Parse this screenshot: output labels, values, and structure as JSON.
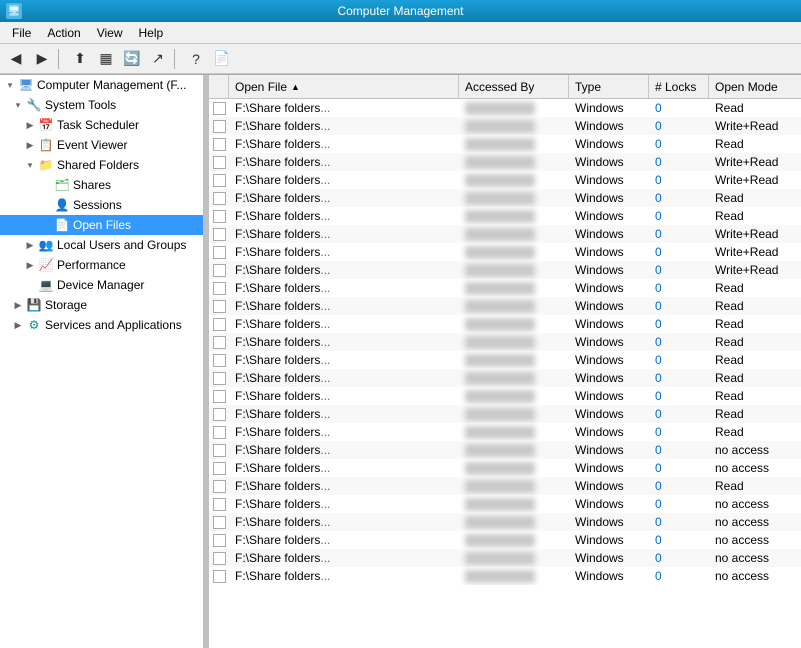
{
  "titleBar": {
    "title": "Computer Management",
    "icon": "🖥"
  },
  "menuBar": {
    "items": [
      "File",
      "Action",
      "View",
      "Help"
    ]
  },
  "toolbar": {
    "buttons": [
      "◀",
      "▶",
      "⬆",
      "📋",
      "🔄",
      "🔍",
      "✔",
      "📄"
    ]
  },
  "tree": {
    "items": [
      {
        "id": "root",
        "label": "Computer Management (F...",
        "icon": "🖥",
        "indent": 0,
        "expanded": true,
        "hasChildren": true
      },
      {
        "id": "system-tools",
        "label": "System Tools",
        "icon": "🔧",
        "indent": 1,
        "expanded": true,
        "hasChildren": true
      },
      {
        "id": "task-scheduler",
        "label": "Task Scheduler",
        "icon": "📅",
        "indent": 2,
        "expanded": false,
        "hasChildren": true
      },
      {
        "id": "event-viewer",
        "label": "Event Viewer",
        "icon": "📋",
        "indent": 2,
        "expanded": false,
        "hasChildren": true
      },
      {
        "id": "shared-folders",
        "label": "Shared Folders",
        "icon": "📁",
        "indent": 2,
        "expanded": true,
        "hasChildren": true
      },
      {
        "id": "shares",
        "label": "Shares",
        "icon": "🗂",
        "indent": 3,
        "expanded": false,
        "hasChildren": false
      },
      {
        "id": "sessions",
        "label": "Sessions",
        "icon": "👤",
        "indent": 3,
        "expanded": false,
        "hasChildren": false
      },
      {
        "id": "open-files",
        "label": "Open Files",
        "icon": "📄",
        "indent": 3,
        "expanded": false,
        "hasChildren": false,
        "selected": true
      },
      {
        "id": "local-users",
        "label": "Local Users and Groups",
        "icon": "👥",
        "indent": 2,
        "expanded": false,
        "hasChildren": true
      },
      {
        "id": "performance",
        "label": "Performance",
        "icon": "📈",
        "indent": 2,
        "expanded": false,
        "hasChildren": true
      },
      {
        "id": "device-manager",
        "label": "Device Manager",
        "icon": "💻",
        "indent": 2,
        "expanded": false,
        "hasChildren": false
      },
      {
        "id": "storage",
        "label": "Storage",
        "icon": "💾",
        "indent": 1,
        "expanded": false,
        "hasChildren": true
      },
      {
        "id": "services",
        "label": "Services and Applications",
        "icon": "⚙",
        "indent": 1,
        "expanded": false,
        "hasChildren": true
      }
    ]
  },
  "table": {
    "columns": [
      {
        "id": "open-file",
        "label": "Open File",
        "sortable": true,
        "sorted": true,
        "sortDir": "asc"
      },
      {
        "id": "accessed-by",
        "label": "Accessed By",
        "sortable": true
      },
      {
        "id": "type",
        "label": "Type",
        "sortable": true
      },
      {
        "id": "locks",
        "label": "# Locks",
        "sortable": true
      },
      {
        "id": "open-mode",
        "label": "Open Mode",
        "sortable": true
      }
    ],
    "rows": [
      {
        "file": "F:\\Share folders",
        "accessedBy": "blurred1",
        "type": "Windows",
        "locks": "0",
        "mode": "Read"
      },
      {
        "file": "F:\\Share folders",
        "accessedBy": "blurred2",
        "type": "Windows",
        "locks": "0",
        "mode": "Write+Read"
      },
      {
        "file": "F:\\Share folders",
        "accessedBy": "blurred3",
        "type": "Windows",
        "locks": "0",
        "mode": "Read"
      },
      {
        "file": "F:\\Share folders",
        "accessedBy": "blurred4",
        "type": "Windows",
        "locks": "0",
        "mode": "Write+Read"
      },
      {
        "file": "F:\\Share folders",
        "accessedBy": "blurred5",
        "type": "Windows",
        "locks": "0",
        "mode": "Write+Read"
      },
      {
        "file": "F:\\Share folders",
        "accessedBy": "blurred6",
        "type": "Windows",
        "locks": "0",
        "mode": "Read"
      },
      {
        "file": "F:\\Share folders",
        "accessedBy": "blurred7",
        "type": "Windows",
        "locks": "0",
        "mode": "Read"
      },
      {
        "file": "F:\\Share folders",
        "accessedBy": "blurred8",
        "type": "Windows",
        "locks": "0",
        "mode": "Write+Read"
      },
      {
        "file": "F:\\Share folders",
        "accessedBy": "blurred9",
        "type": "Windows",
        "locks": "0",
        "mode": "Write+Read"
      },
      {
        "file": "F:\\Share folders",
        "accessedBy": "blurred10",
        "type": "Windows",
        "locks": "0",
        "mode": "Write+Read"
      },
      {
        "file": "F:\\Share folders",
        "accessedBy": "blurred11",
        "type": "Windows",
        "locks": "0",
        "mode": "Read"
      },
      {
        "file": "F:\\Share folders",
        "accessedBy": "blurred12",
        "type": "Windows",
        "locks": "0",
        "mode": "Read"
      },
      {
        "file": "F:\\Share folders",
        "accessedBy": "blurred13",
        "type": "Windows",
        "locks": "0",
        "mode": "Read"
      },
      {
        "file": "F:\\Share folders",
        "accessedBy": "blurred14",
        "type": "Windows",
        "locks": "0",
        "mode": "Read"
      },
      {
        "file": "F:\\Share folders",
        "accessedBy": "blurred15",
        "type": "Windows",
        "locks": "0",
        "mode": "Read"
      },
      {
        "file": "F:\\Share folders",
        "accessedBy": "blurred16",
        "type": "Windows",
        "locks": "0",
        "mode": "Read"
      },
      {
        "file": "F:\\Share folders",
        "accessedBy": "blurred17",
        "type": "Windows",
        "locks": "0",
        "mode": "Read"
      },
      {
        "file": "F:\\Share folders",
        "accessedBy": "blurred18",
        "type": "Windows",
        "locks": "0",
        "mode": "Read"
      },
      {
        "file": "F:\\Share folders",
        "accessedBy": "blurred19",
        "type": "Windows",
        "locks": "0",
        "mode": "Read"
      },
      {
        "file": "F:\\Share folders",
        "accessedBy": "blurred20",
        "type": "Windows",
        "locks": "0",
        "mode": "no access"
      },
      {
        "file": "F:\\Share folders",
        "accessedBy": "blurred21",
        "type": "Windows",
        "locks": "0",
        "mode": "no access"
      },
      {
        "file": "F:\\Share folders",
        "accessedBy": "blurred22",
        "type": "Windows",
        "locks": "0",
        "mode": "Read"
      },
      {
        "file": "F:\\Share folders",
        "accessedBy": "blurred23",
        "type": "Windows",
        "locks": "0",
        "mode": "no access"
      },
      {
        "file": "F:\\Share folders",
        "accessedBy": "blurred24",
        "type": "Windows",
        "locks": "0",
        "mode": "no access"
      },
      {
        "file": "F:\\Share folders",
        "accessedBy": "blurred25",
        "type": "Windows",
        "locks": "0",
        "mode": "no access"
      },
      {
        "file": "F:\\Share folders",
        "accessedBy": "blurred26",
        "type": "Windows",
        "locks": "0",
        "mode": "no access"
      },
      {
        "file": "F:\\Share folders",
        "accessedBy": "blurred27",
        "type": "Windows",
        "locks": "0",
        "mode": "no access"
      }
    ]
  }
}
